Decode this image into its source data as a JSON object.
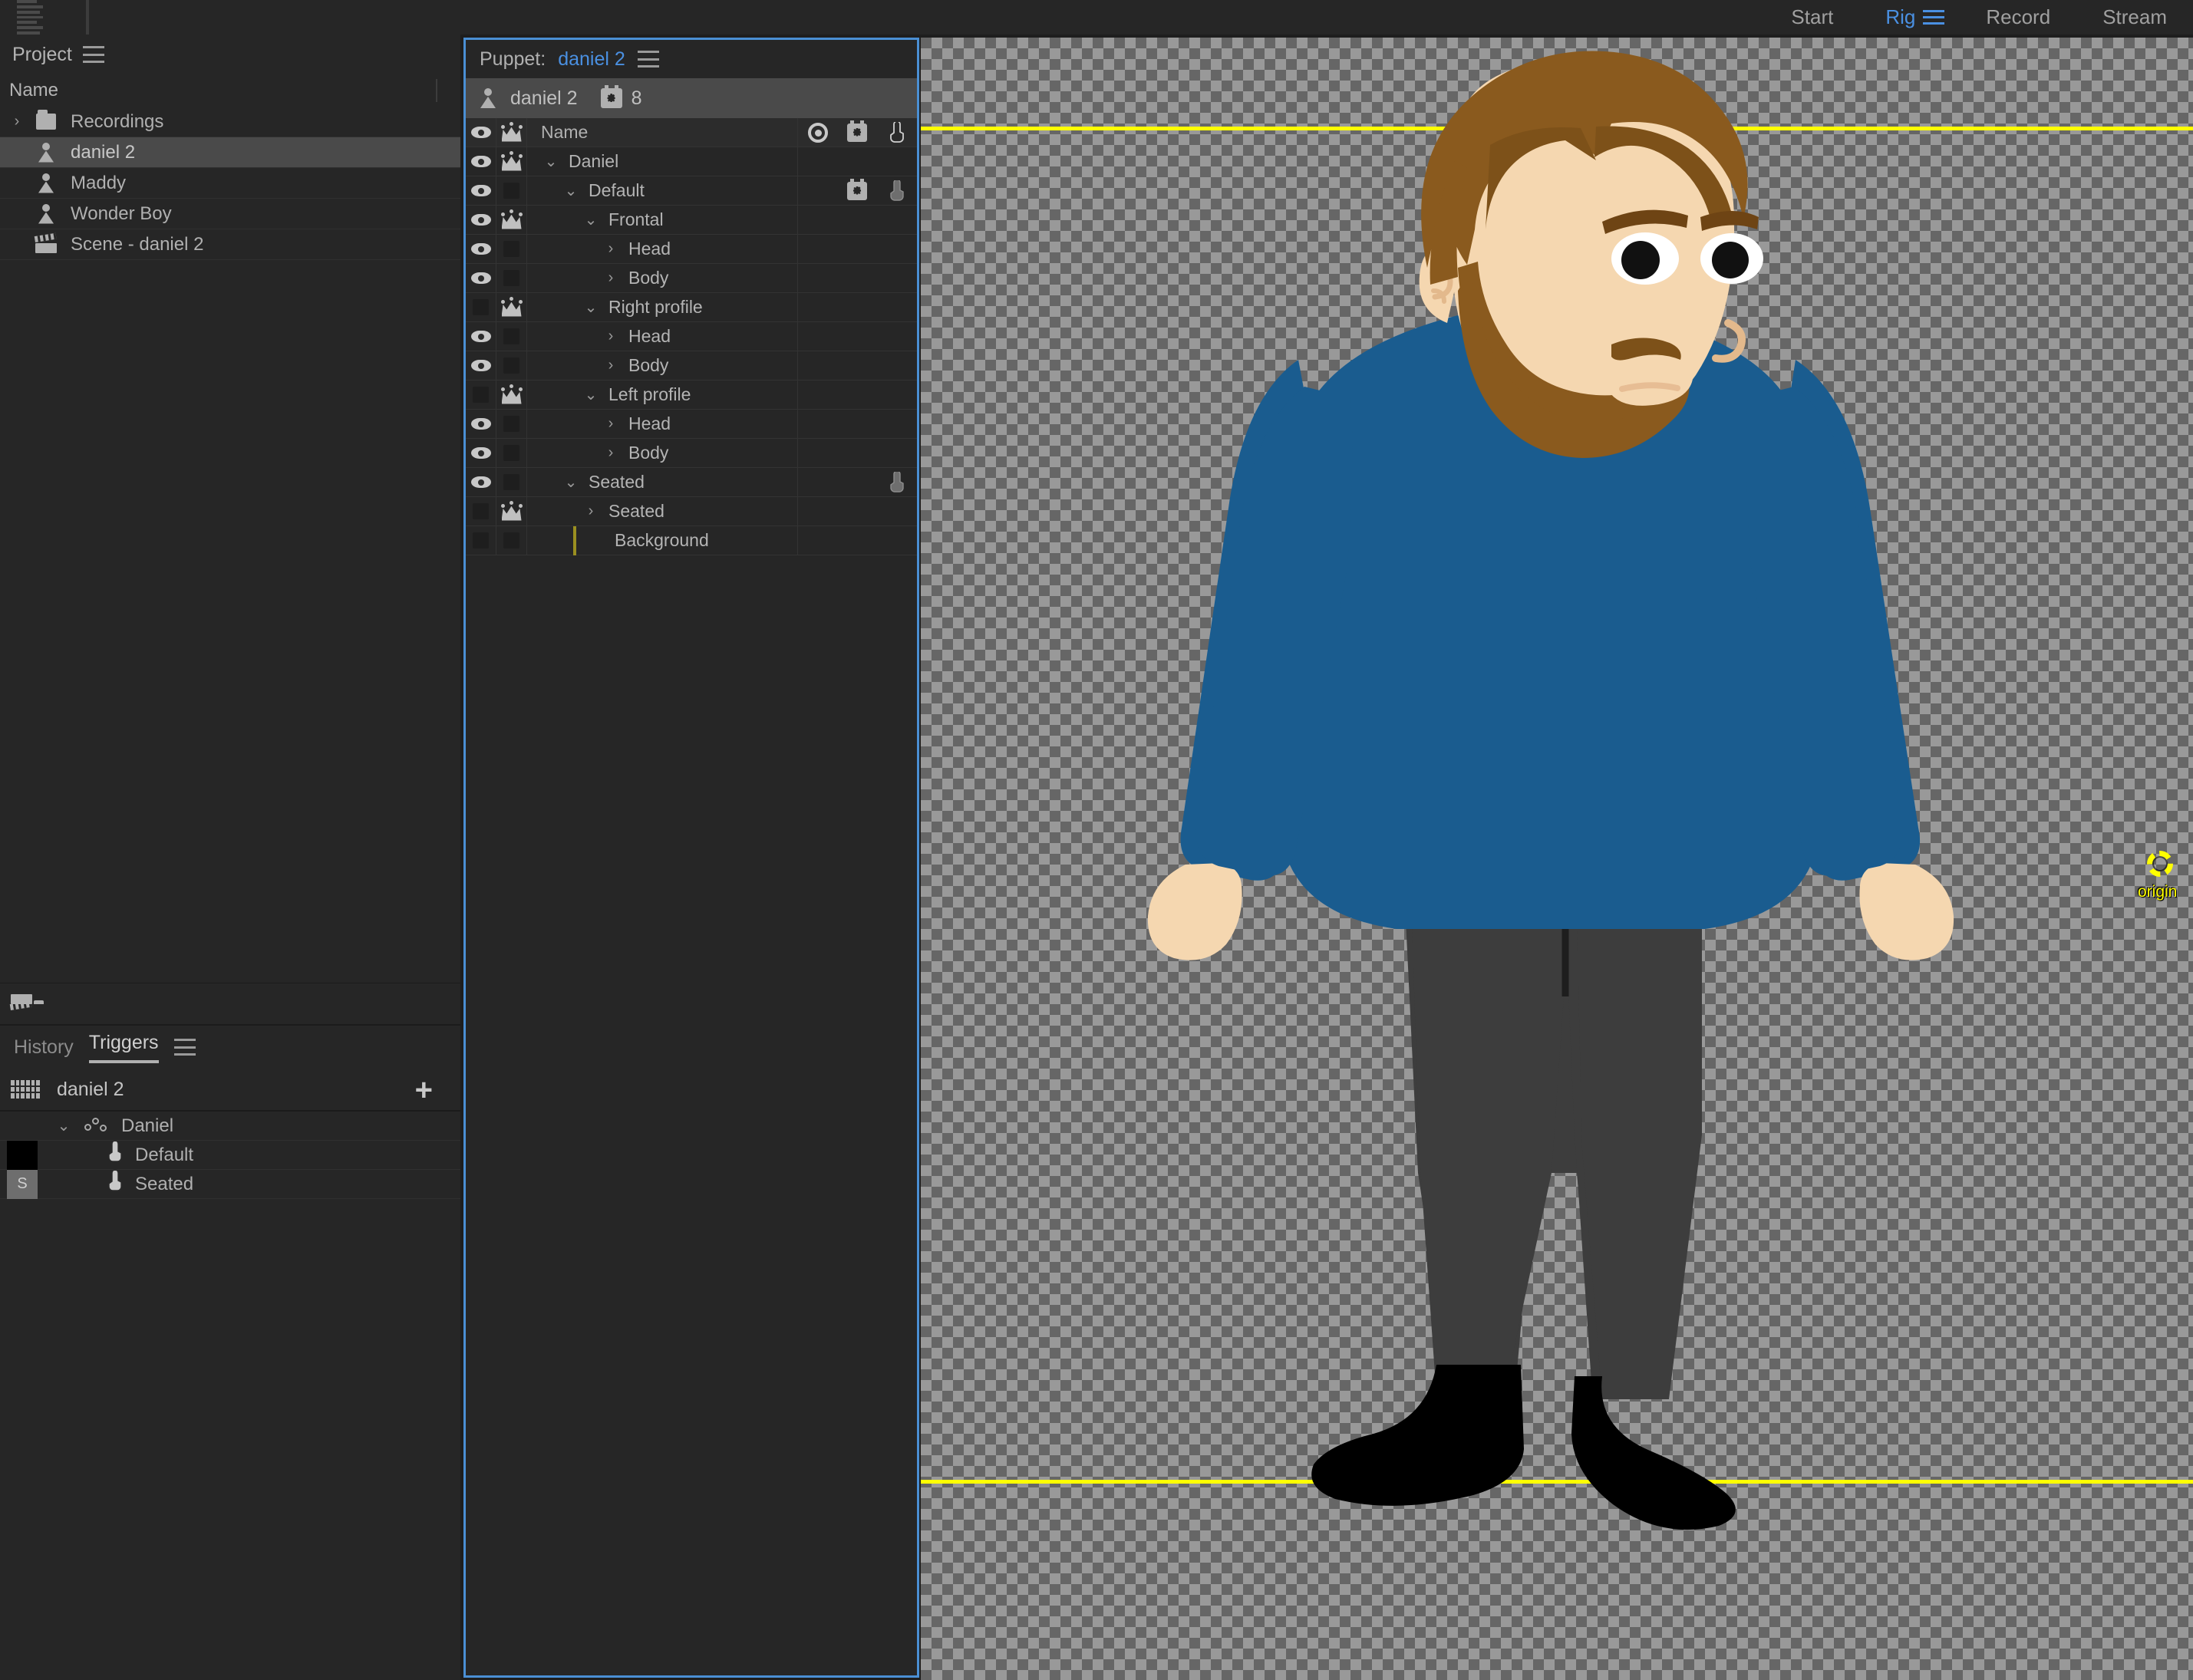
{
  "topbar": {
    "hamburger_icon": "app-menu-icon",
    "nav": [
      {
        "label": "Start",
        "active": false
      },
      {
        "label": "Rig",
        "active": true
      },
      {
        "label": "Record",
        "active": false
      },
      {
        "label": "Stream",
        "active": false
      }
    ],
    "workspace_menu_icon": "workspace-menu-icon"
  },
  "project": {
    "tab_label": "Project",
    "menu_icon": "panel-menu-icon",
    "column_header": "Name",
    "rows": [
      {
        "name": "Recordings",
        "icon": "folder-icon",
        "twisty": "›",
        "indent": 0,
        "selected": false
      },
      {
        "name": "daniel 2",
        "icon": "puppet-icon",
        "twisty": "",
        "indent": 1,
        "selected": true
      },
      {
        "name": "Maddy",
        "icon": "puppet-icon",
        "twisty": "",
        "indent": 1,
        "selected": false
      },
      {
        "name": "Wonder Boy",
        "icon": "puppet-icon",
        "twisty": "",
        "indent": 1,
        "selected": false
      },
      {
        "name": "Scene - daniel 2",
        "icon": "scene-clapper-icon",
        "twisty": "",
        "indent": 1,
        "selected": false
      }
    ],
    "bottom_buttons": [
      {
        "name": "new-scene-button",
        "icon": "clapper-icon"
      },
      {
        "name": "new-folder-button",
        "icon": "folder-icon"
      }
    ]
  },
  "triggers": {
    "tabs": [
      {
        "label": "History",
        "active": false
      },
      {
        "label": "Triggers",
        "active": true
      }
    ],
    "menu_icon": "panel-menu-icon",
    "puppet_name": "daniel 2",
    "keyboard_icon": "keyboard-icon",
    "add_icon": "+",
    "rows": [
      {
        "label": "Daniel",
        "icon": "swap-set-icon",
        "twisty": "⌄",
        "indent": 0,
        "key": "",
        "swatch": "none"
      },
      {
        "label": "Default",
        "icon": "trigger-hand-icon",
        "twisty": "",
        "indent": 1,
        "key": "",
        "swatch": "#000000"
      },
      {
        "label": "Seated",
        "icon": "trigger-hand-icon",
        "twisty": "",
        "indent": 1,
        "key": "S",
        "swatch": "#6e6e6e"
      }
    ]
  },
  "puppet_panel": {
    "title_prefix": "Puppet:",
    "title_name": "daniel 2",
    "menu_icon": "panel-menu-icon",
    "puppet_row": {
      "name": "daniel 2",
      "icon": "puppet-icon",
      "behaviors_icon": "behaviors-icon",
      "behaviors_count": "8"
    },
    "columns": {
      "name": "Name",
      "record_icon": "record-target-icon",
      "behaviors_icon": "behaviors-icon",
      "trigger_icon": "trigger-hand-icon"
    },
    "layers": [
      {
        "name": "Daniel",
        "indent": 0,
        "twisty": "⌄",
        "eye": true,
        "crown": true,
        "behaviors": false,
        "trigger": false,
        "bg_bar": false
      },
      {
        "name": "Default",
        "indent": 1,
        "twisty": "⌄",
        "eye": true,
        "crown": false,
        "behaviors": true,
        "trigger": true,
        "bg_bar": false
      },
      {
        "name": "Frontal",
        "indent": 2,
        "twisty": "⌄",
        "eye": true,
        "crown": true,
        "behaviors": false,
        "trigger": false,
        "bg_bar": false
      },
      {
        "name": "Head",
        "indent": 3,
        "twisty": "›",
        "eye": true,
        "crown": false,
        "behaviors": false,
        "trigger": false,
        "bg_bar": false
      },
      {
        "name": "Body",
        "indent": 3,
        "twisty": "›",
        "eye": true,
        "crown": false,
        "behaviors": false,
        "trigger": false,
        "bg_bar": false
      },
      {
        "name": "Right profile",
        "indent": 2,
        "twisty": "⌄",
        "eye": false,
        "crown": true,
        "behaviors": false,
        "trigger": false,
        "bg_bar": false
      },
      {
        "name": "Head",
        "indent": 3,
        "twisty": "›",
        "eye": true,
        "crown": false,
        "behaviors": false,
        "trigger": false,
        "bg_bar": false
      },
      {
        "name": "Body",
        "indent": 3,
        "twisty": "›",
        "eye": true,
        "crown": false,
        "behaviors": false,
        "trigger": false,
        "bg_bar": false
      },
      {
        "name": "Left profile",
        "indent": 2,
        "twisty": "⌄",
        "eye": false,
        "crown": true,
        "behaviors": false,
        "trigger": false,
        "bg_bar": false
      },
      {
        "name": "Head",
        "indent": 3,
        "twisty": "›",
        "eye": true,
        "crown": false,
        "behaviors": false,
        "trigger": false,
        "bg_bar": false
      },
      {
        "name": "Body",
        "indent": 3,
        "twisty": "›",
        "eye": true,
        "crown": false,
        "behaviors": false,
        "trigger": false,
        "bg_bar": false
      },
      {
        "name": "Seated",
        "indent": 1,
        "twisty": "⌄",
        "eye": true,
        "crown": false,
        "behaviors": false,
        "trigger": true,
        "bg_bar": false
      },
      {
        "name": "Seated",
        "indent": 2,
        "twisty": "›",
        "eye": false,
        "crown": true,
        "behaviors": false,
        "trigger": false,
        "bg_bar": false
      },
      {
        "name": "Background",
        "indent": 2,
        "twisty": "",
        "eye": false,
        "crown": false,
        "behaviors": false,
        "trigger": false,
        "bg_bar": true
      }
    ]
  },
  "canvas": {
    "origin_label": "origin",
    "origin_marker_icon": "origin-crosshair-icon",
    "dragger_icon": "dragger-handle-icon",
    "guides_color": "#ffff00",
    "colors": {
      "skin": "#f5d7b0",
      "hair": "#8a5a1e",
      "beard": "#8a5a1e",
      "sweater": "#1a5c8f",
      "shirt": "#ffffff",
      "pants": "#3d3d3d",
      "shoes": "#000000",
      "origin": "#ffff00",
      "dragger": "#19b319"
    }
  }
}
